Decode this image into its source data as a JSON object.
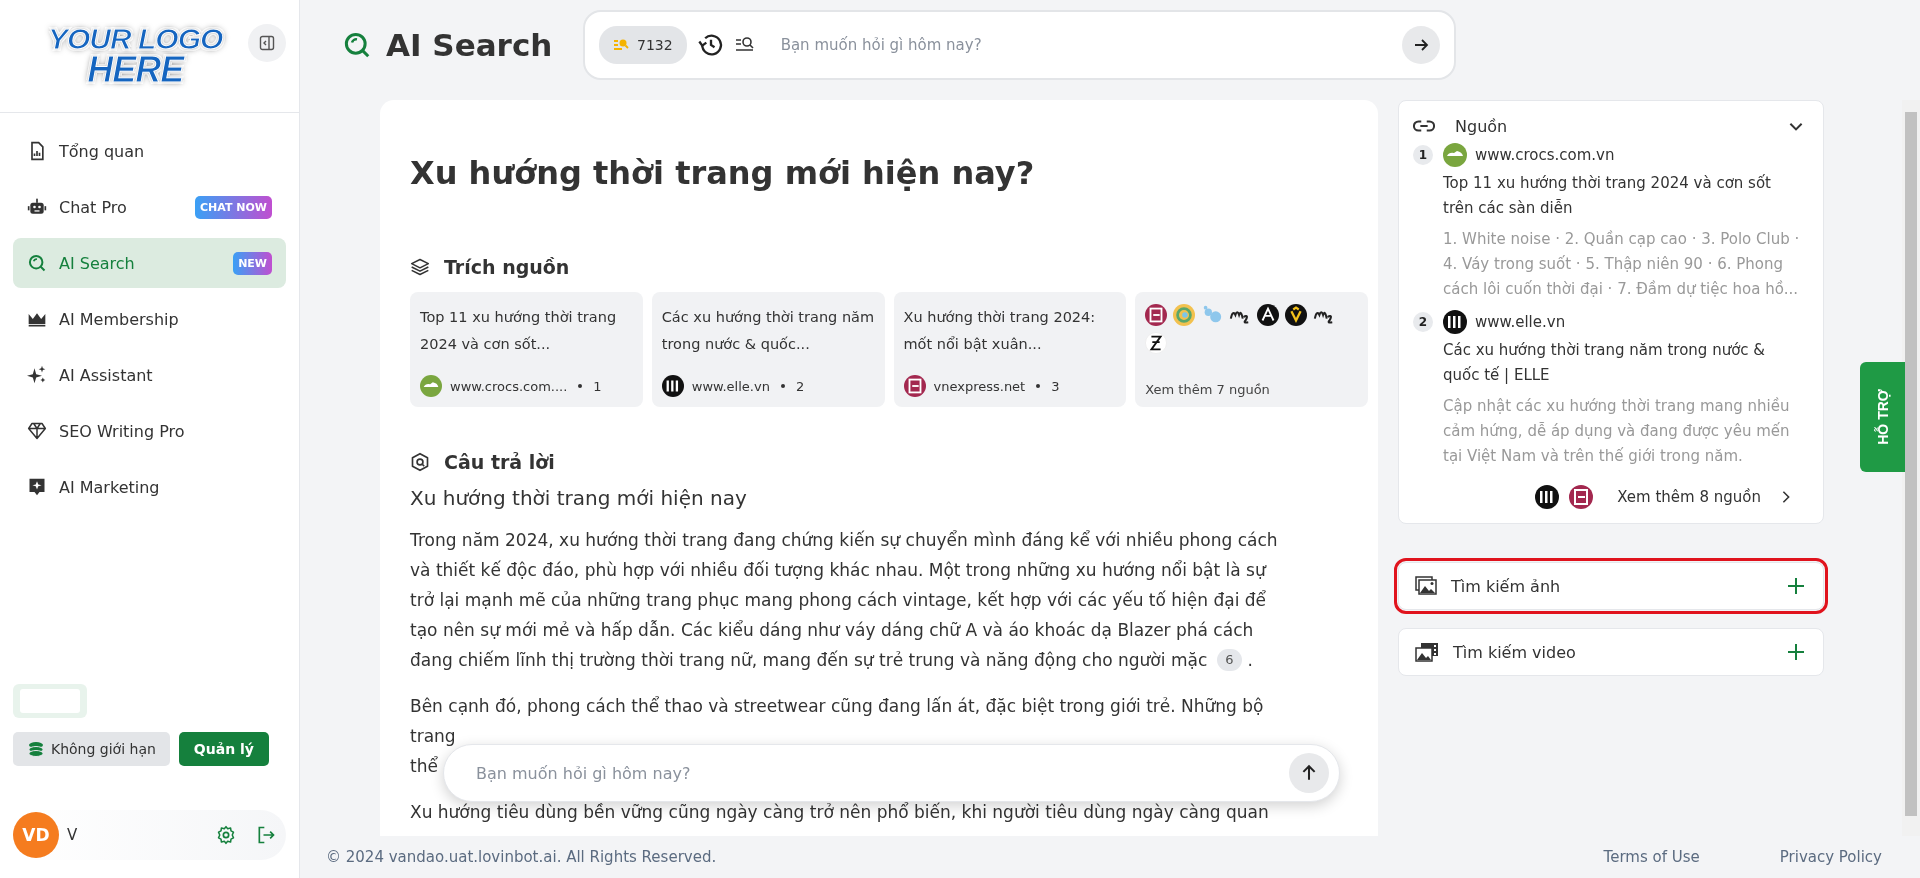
{
  "logo": {
    "lines": [
      "YOUR LOGO",
      "HERE"
    ]
  },
  "sidebar": {
    "items": [
      {
        "label": "Tổng quan",
        "selected": false
      },
      {
        "label": "Chat Pro",
        "badge": "CHAT NOW",
        "selected": false
      },
      {
        "label": "AI Search",
        "badge": "NEW",
        "selected": true
      },
      {
        "label": "AI Membership",
        "selected": false
      },
      {
        "label": "AI Assistant",
        "selected": false
      },
      {
        "label": "SEO Writing Pro",
        "selected": false
      },
      {
        "label": "AI Marketing",
        "selected": false
      }
    ],
    "plan": "Không giới hạn",
    "manage": "Quản lý",
    "user": {
      "initials": "VD",
      "name": "V"
    }
  },
  "header": {
    "title": "AI Search",
    "credits": "7132",
    "placeholder": "Bạn muốn hỏi gì hôm nay?"
  },
  "answer": {
    "question": "Xu hướng thời trang mới hiện nay?",
    "citations": {
      "heading": "Trích nguồn",
      "cards": [
        {
          "title": "Top 11 xu hướng thời trang 2024 và cơn sốt...",
          "site": "www.crocs.com....",
          "index": "1"
        },
        {
          "title": "Các xu hướng thời trang năm trong nước & quốc...",
          "site": "www.elle.vn",
          "index": "2"
        },
        {
          "title": "Xu hướng thời trang 2024: mốt nổi bật xuân...",
          "site": "vnexpress.net",
          "index": "3"
        }
      ],
      "more": {
        "label": "Xem thêm 7 nguồn"
      }
    },
    "heading": "Câu trả lời",
    "subtitle": "Xu hướng thời trang mới hiện nay",
    "paragraphs": [
      {
        "lines": [
          "Trong năm 2024, xu hướng thời trang đang chứng kiến sự chuyển mình đáng kể với nhiều phong cách",
          "và thiết kế độc đáo, phù hợp với nhiều đối tượng khác nhau. Một trong những xu hướng nổi bật là sự",
          "trở lại mạnh mẽ của những trang phục mang phong cách vintage, kết hợp với các yếu tố hiện đại để",
          "tạo nên sự mới mẻ và hấp dẫn. Các kiểu dáng như váy dáng chữ A và áo khoác dạ Blazer phá cách",
          "đang chiếm lĩnh thị trường thời trang nữ, mang đến sự trẻ trung và năng động cho người mặc"
        ],
        "citation": "6",
        "tail": "."
      },
      {
        "lines": [
          "Bên cạnh đó, phong cách thể thao và streetwear cũng đang lấn át, đặc biệt trong giới trẻ. Những bộ",
          "trang",
          "thể"
        ]
      },
      {
        "lines": [
          "Xu hướng tiêu dùng bền vững cũng ngày càng trở nên phổ biến, khi người tiêu dùng ngày càng quan"
        ]
      }
    ]
  },
  "ask_bar": {
    "placeholder": "Bạn muốn hỏi gì hôm nay?"
  },
  "sources": {
    "title": "Nguồn",
    "expanded": true,
    "items": [
      {
        "index": "1",
        "site": "www.crocs.com.vn",
        "title": "Top 11 xu hướng thời trang 2024 và cơn sốt trên các sàn diễn",
        "snippet": "1. White noise · 2. Quần cạp cao · 3. Polo Club · 4. Váy trong suốt · 5. Thập niên 90 · 6. Phong cách lôi cuốn thời đại · 7. Đầm dự tiệc hoa hồ..."
      },
      {
        "index": "2",
        "site": "www.elle.vn",
        "title": "Các xu hướng thời trang năm trong nước & quốc tế | ELLE",
        "snippet": "Cập nhật các xu hướng thời trang mang nhiều cảm hứng, dễ áp dụng và đang được yêu mến tại Việt Nam và trên thế giới trong năm."
      }
    ],
    "more": {
      "label": "Xem thêm 8 nguồn"
    }
  },
  "tools": [
    {
      "label": "Tìm kiếm ảnh",
      "highlighted": true
    },
    {
      "label": "Tìm kiếm video",
      "highlighted": false
    }
  ],
  "support_tab": "HỖ TRỢ",
  "footer": {
    "copyright": "© 2024 vandao.uat.lovinbot.ai. All Rights Reserved.",
    "links": [
      "Terms of Use",
      "Privacy Policy"
    ]
  }
}
